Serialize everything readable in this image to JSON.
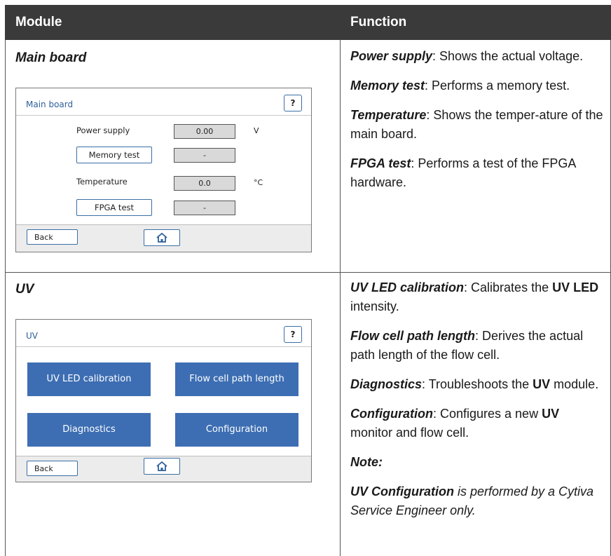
{
  "table": {
    "headers": {
      "module": "Module",
      "function": "Function"
    },
    "rows": [
      {
        "module": "Main board",
        "screen": {
          "title": "Main board",
          "help_label": "?",
          "back_label": "Back",
          "rows": [
            {
              "label": "Power supply",
              "value": "0.00",
              "unit": "V"
            },
            {
              "button": "Memory test",
              "value": "-"
            },
            {
              "label": "Temperature",
              "value": "0.0",
              "unit": "°C"
            },
            {
              "button": "FPGA test",
              "value": "-"
            }
          ]
        },
        "functions": [
          {
            "term": "Power supply",
            "text": ": Shows the actual voltage."
          },
          {
            "term": "Memory test",
            "text": ": Performs a memory test."
          },
          {
            "term": "Temperature",
            "text": ": Shows the temper-ature of the main board."
          },
          {
            "term": "FPGA test",
            "text": ": Performs a test of the FPGA hardware."
          }
        ]
      },
      {
        "module": "UV",
        "screen": {
          "title": "UV",
          "help_label": "?",
          "back_label": "Back",
          "buttons": [
            "UV LED calibration",
            "Flow cell path length",
            "Diagnostics",
            "Configuration"
          ]
        },
        "functions": [
          {
            "term": "UV LED calibration",
            "text_a": ": Calibrates the ",
            "bold": "UV LED",
            "text_b": " intensity."
          },
          {
            "term": "Flow cell path length",
            "text": ": Derives the actual path length of the flow cell."
          },
          {
            "term": "Diagnostics",
            "text_a": ": Troubleshoots the ",
            "bold": "UV",
            "text_b": " module."
          },
          {
            "term": "Configuration",
            "text_a": ": Configures a new ",
            "bold": "UV",
            "text_b": " monitor and flow cell."
          }
        ],
        "note": {
          "title": "Note:",
          "term": "UV Configuration",
          "text": " is performed by a Cytiva Service Engineer only."
        }
      }
    ]
  },
  "icons": {
    "home": "home-icon"
  },
  "colors": {
    "header_bg": "#3a3a3a",
    "screen_accent": "#3d6eb3"
  }
}
